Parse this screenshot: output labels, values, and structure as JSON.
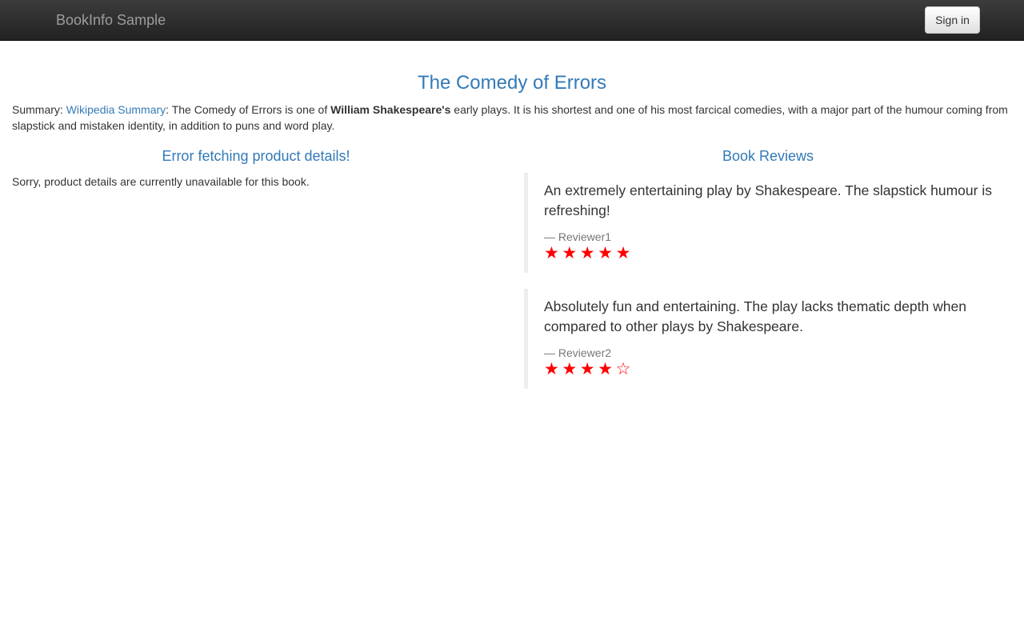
{
  "navbar": {
    "brand": "BookInfo Sample",
    "signin_label": "Sign in"
  },
  "product": {
    "title": "The Comedy of Errors",
    "summary_prefix": "Summary: ",
    "summary_link": "Wikipedia Summary",
    "summary_text_1": ": The Comedy of Errors is one of ",
    "summary_bold": "William Shakespeare's",
    "summary_text_2": " early plays. It is his shortest and one of his most farcical comedies, with a major part of the humour coming from slapstick and mistaken identity, in addition to puns and word play."
  },
  "details": {
    "title": "Error fetching product details!",
    "message": "Sorry, product details are currently unavailable for this book."
  },
  "reviews": {
    "title": "Book Reviews",
    "items": [
      {
        "text": "An extremely entertaining play by Shakespeare. The slapstick humour is refreshing!",
        "author": "— Reviewer1",
        "rating": 5,
        "max_rating": 5
      },
      {
        "text": "Absolutely fun and entertaining. The play lacks thematic depth when compared to other plays by Shakespeare.",
        "author": "— Reviewer2",
        "rating": 4,
        "max_rating": 5
      }
    ]
  },
  "colors": {
    "accent": "#337ab7",
    "star": "#ff0000",
    "navbar": "#222222"
  },
  "icons": {
    "filled_star": "star-filled-icon",
    "empty_star": "star-empty-icon"
  }
}
